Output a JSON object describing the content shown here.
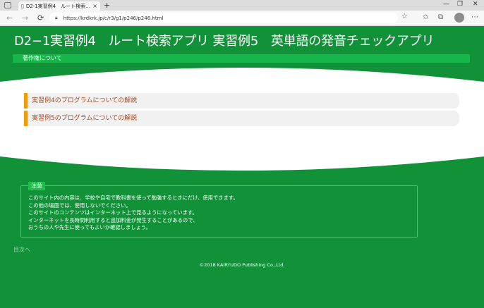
{
  "browser": {
    "tab_title": "D2-1実習例4　ルート検索アプリ 実",
    "tab_close": "×",
    "new_tab": "+",
    "url": "https://krdkrk.jp/c/r3/g1/p246/p246.html",
    "window_controls": [
      "—",
      "❐",
      "✕"
    ],
    "nav": {
      "back": "←",
      "forward": "→",
      "reload": "⟳"
    }
  },
  "page": {
    "title": "D2−1実習例4　ルート検索アプリ 実習例5　英単語の発音チェックアプリ",
    "copyright_nav": "著作権について",
    "links": [
      "実習例4のプログラムについての解説",
      "実習例5のプログラムについての解説"
    ],
    "notice": {
      "label": "注意",
      "lines": [
        "このサイト内の内容は、学校や自宅で教科書を使って勉強するときにだけ、使用できます。",
        "この他の場面では、使用しないでください。",
        "このサイトのコンテンツはインターネット上で見るようになっています。",
        "インターネットを長時間利用すると追加料金が発生することがあるので、",
        "おうちの人や先生に使ってもよいか確認しましょう。"
      ]
    },
    "back_link": "目次へ",
    "copyright": "©2018 KAIRYUDO Publishing Co.,Ltd."
  },
  "colors": {
    "background": "#119138",
    "subbar": "#16b64a",
    "link_accent": "#f29a0c",
    "link_text": "#a7451a"
  }
}
